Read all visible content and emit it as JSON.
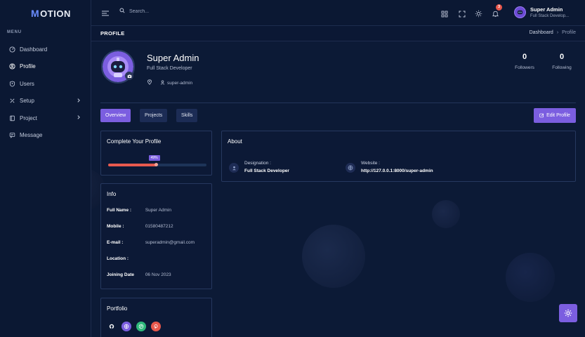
{
  "app": {
    "logo_text": "OTION",
    "logo_mark": "M"
  },
  "sidebar": {
    "menu_header": "MENU",
    "items": [
      {
        "label": "Dashboard",
        "icon": "dashboard-icon"
      },
      {
        "label": "Profile",
        "icon": "user-circle-icon",
        "active": true
      },
      {
        "label": "Users",
        "icon": "shield-user-icon"
      },
      {
        "label": "Setup",
        "icon": "tools-icon",
        "has_children": true
      },
      {
        "label": "Project",
        "icon": "book-icon",
        "has_children": true
      },
      {
        "label": "Message",
        "icon": "message-icon"
      }
    ]
  },
  "topbar": {
    "search_placeholder": "Search...",
    "notification_count": "3",
    "user_name": "Super Admin",
    "user_role": "Full Stack Develop..."
  },
  "pagebar": {
    "title": "PROFILE",
    "breadcrumb": [
      "Dashboard",
      "Profile"
    ]
  },
  "profile": {
    "name": "Super Admin",
    "role": "Full Stack Developer",
    "username": "super-admin",
    "followers_count": "0",
    "followers_label": "Followers",
    "following_count": "0",
    "following_label": "Following"
  },
  "tabs": [
    "Overview",
    "Projects",
    "Skills"
  ],
  "edit_button": "Edit Profile",
  "complete_profile": {
    "title": "Complete Your Profile",
    "percent_label": "49%",
    "percent": 49
  },
  "info": {
    "title": "Info",
    "rows": [
      {
        "key": "Full Name :",
        "value": "Super Admin"
      },
      {
        "key": "Mobile :",
        "value": "01580487212"
      },
      {
        "key": "E-mail :",
        "value": "superadmin@gmail.com"
      },
      {
        "key": "Location :",
        "value": ""
      },
      {
        "key": "Joining Date",
        "value": "06 Nov 2023"
      }
    ]
  },
  "about": {
    "title": "About",
    "designation_label": "Designation :",
    "designation_value": "Full Stack Developer",
    "website_label": "Website :",
    "website_value": "http://127.0.0.1:8000/super-admin"
  },
  "portfolio": {
    "title": "Portfolio",
    "links": [
      {
        "icon": "github-icon",
        "color": "#0c1a36"
      },
      {
        "icon": "globe-icon",
        "color": "#7b5ee0"
      },
      {
        "icon": "dribbble-icon",
        "color": "#2fb97b"
      },
      {
        "icon": "pinterest-icon",
        "color": "#e8574c"
      }
    ]
  },
  "colors": {
    "accent": "#7b5ee0",
    "background": "#0c1a36",
    "progress": "#e85a4f"
  }
}
